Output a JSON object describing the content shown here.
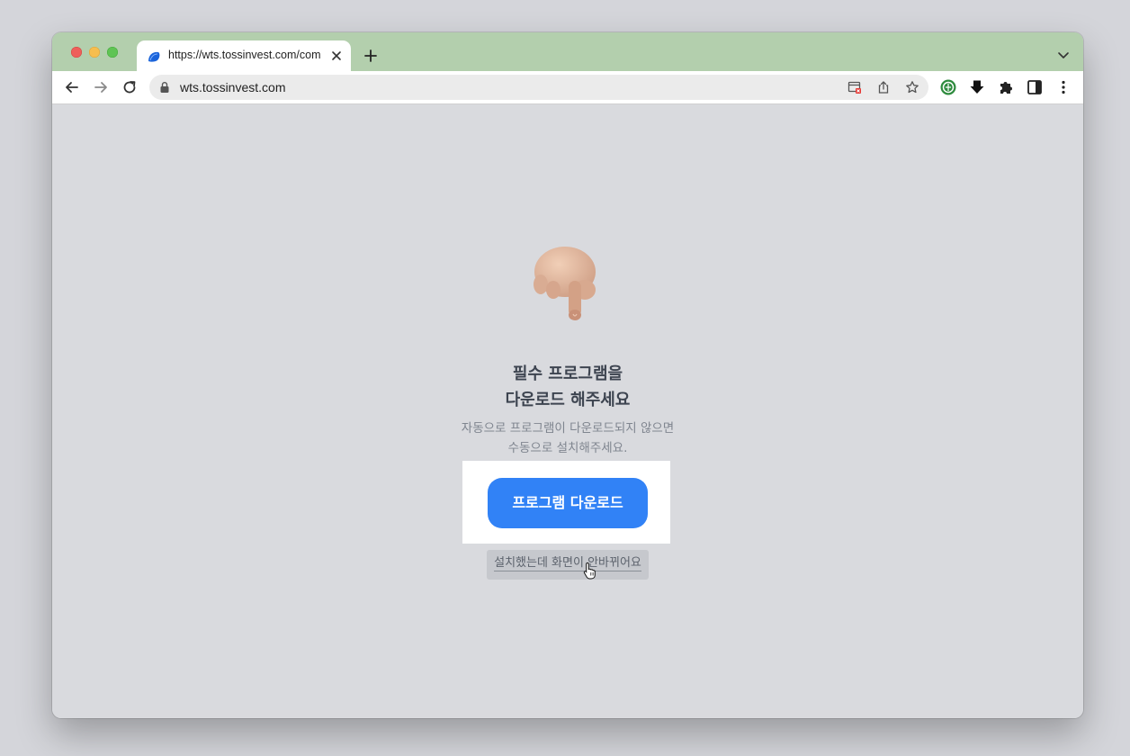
{
  "browser": {
    "tab": {
      "title": "https://wts.tossinvest.com/com"
    },
    "address_bar": {
      "url": "wts.tossinvest.com"
    }
  },
  "page": {
    "heading_line1": "필수 프로그램을",
    "heading_line2": "다운로드 해주세요",
    "subtitle_line1": "자동으로 프로그램이 다운로드되지 않으면",
    "subtitle_line2": "수동으로 설치해주세요.",
    "download_button": "프로그램 다운로드",
    "installed_link": "설치했는데 화면이 안바뀌어요"
  },
  "colors": {
    "accent": "#3182f6",
    "tabstrip": "#b3cfad",
    "page_background": "#d9dade"
  }
}
